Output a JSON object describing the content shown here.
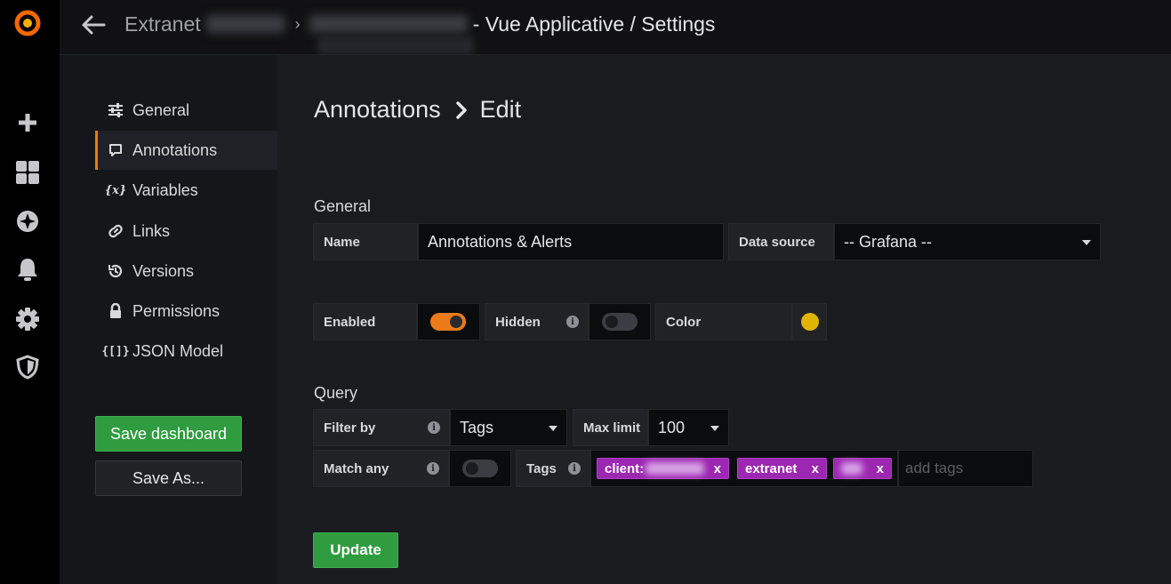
{
  "topbar": {
    "folder": "Extranet",
    "title_suffix": "- Vue Applicative / Settings"
  },
  "rail": {
    "icons": [
      "grafana-logo-icon",
      "plus-icon",
      "dashboards-icon",
      "explore-compass-icon",
      "alerting-bell-icon",
      "configuration-gear-icon",
      "server-admin-shield-icon"
    ]
  },
  "settings_nav": {
    "items": [
      {
        "label": "General",
        "icon": "sliders-icon"
      },
      {
        "label": "Annotations",
        "icon": "comment-icon"
      },
      {
        "label": "Variables",
        "icon": "variable-icon"
      },
      {
        "label": "Links",
        "icon": "link-icon"
      },
      {
        "label": "Versions",
        "icon": "history-icon"
      },
      {
        "label": "Permissions",
        "icon": "lock-icon"
      },
      {
        "label": "JSON Model",
        "icon": "json-brackets-icon"
      }
    ],
    "active": "Annotations",
    "save_label": "Save dashboard",
    "save_as_label": "Save As..."
  },
  "page": {
    "title": "Annotations",
    "subtitle": "Edit"
  },
  "general": {
    "heading": "General",
    "name_label": "Name",
    "name_value": "Annotations & Alerts",
    "datasource_label": "Data source",
    "datasource_value": "-- Grafana --",
    "enabled_label": "Enabled",
    "enabled": true,
    "hidden_label": "Hidden",
    "hidden": false,
    "color_label": "Color"
  },
  "query": {
    "heading": "Query",
    "filter_label": "Filter by",
    "filter_value": "Tags",
    "max_limit_label": "Max limit",
    "max_limit_value": "100",
    "match_any_label": "Match any",
    "match_any": false,
    "tags_label": "Tags",
    "tags": [
      {
        "text": "client:",
        "remove": "x"
      },
      {
        "text": "extranet",
        "remove": "x"
      },
      {
        "text": "",
        "remove": "x"
      }
    ],
    "tags_placeholder": "add tags"
  },
  "update_label": "Update",
  "colors": {
    "accent_orange": "#eb7b18",
    "success_green": "#2f9c3f",
    "tag_purple": "#9c27b0",
    "annotation_color": "#e0b400"
  }
}
